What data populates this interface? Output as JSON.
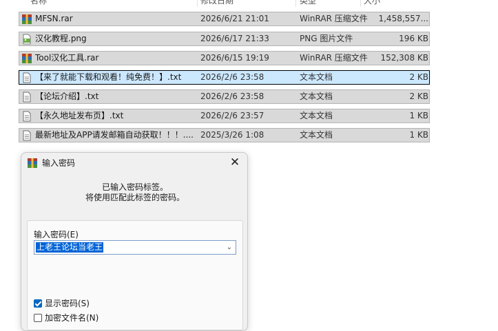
{
  "columns": {
    "name": "名称",
    "date": "修改日期",
    "type": "类型",
    "size": "大小"
  },
  "files": [
    {
      "name": "MFSN.rar",
      "date": "2026/6/21 21:01",
      "type": "WinRAR 压缩文件",
      "size": "1,458,557...",
      "icon": "winrar-archive-icon",
      "selected": false
    },
    {
      "name": "汉化教程.png",
      "date": "2026/6/17 21:33",
      "type": "PNG 图片文件",
      "size": "196 KB",
      "icon": "png-image-icon",
      "selected": false
    },
    {
      "name": "Tool汉化工具.rar",
      "date": "2026/6/15 19:19",
      "type": "WinRAR 压缩文件",
      "size": "152,308 KB",
      "icon": "winrar-archive-icon",
      "selected": false
    },
    {
      "name": "【来了就能下载和观看！纯免费！】.txt",
      "date": "2026/2/6 23:58",
      "type": "文本文档",
      "size": "2 KB",
      "icon": "text-document-icon",
      "selected": true
    },
    {
      "name": "【论坛介绍】.txt",
      "date": "2026/2/6 23:58",
      "type": "文本文档",
      "size": "2 KB",
      "icon": "text-document-icon",
      "selected": false
    },
    {
      "name": "【永久地址发布页】.txt",
      "date": "2026/2/6 23:57",
      "type": "文本文档",
      "size": "1 KB",
      "icon": "text-document-icon",
      "selected": false
    },
    {
      "name": "最新地址及APP请发邮箱自动获取！！！....",
      "date": "2025/3/26 1:08",
      "type": "文本文档",
      "size": "1 KB",
      "icon": "text-document-icon",
      "selected": false
    }
  ],
  "dialog": {
    "title": "输入密码",
    "message_line1": "已输入密码标签。",
    "message_line2": "将使用匹配此标签的密码。",
    "password_label": "输入密码(E)",
    "password_value": "上老王论坛当老王",
    "show_password_label": "显示密码(S)",
    "show_password_checked": true,
    "encrypt_filenames_label": "加密文件名(N)",
    "encrypt_filenames_checked": false
  },
  "colors": {
    "row_bg": "#d9d9d9",
    "selected_row_bg": "#cce8ff",
    "selection_highlight": "#0063d6",
    "checkbox_accent": "#0067c0"
  }
}
